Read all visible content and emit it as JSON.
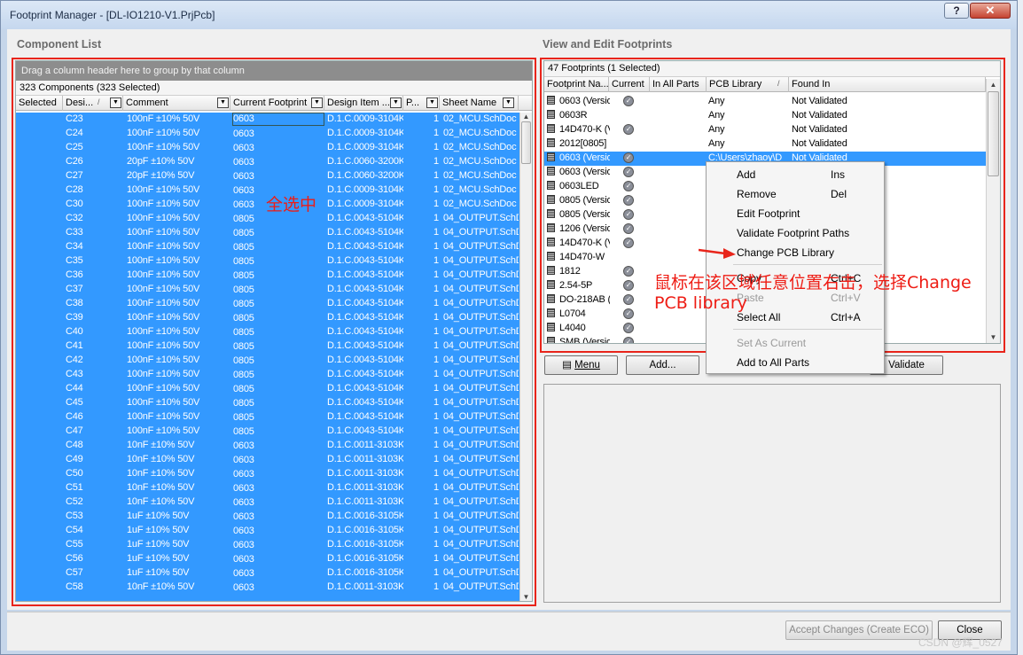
{
  "window": {
    "title": "Footprint Manager - [DL-IO1210-V1.PrjPcb]",
    "help_label": "?",
    "close_label": "✕"
  },
  "left": {
    "group_title": "Component List",
    "group_panel": "Drag a column header here to group by that column",
    "count": "323 Components (323 Selected)",
    "columns": [
      "Selected",
      "Desi...",
      "Comment",
      "Current Footprint",
      "Design Item ...",
      "P...",
      "Sheet Name"
    ],
    "rows": [
      {
        "des": "C23",
        "comment": "100nF ±10% 50V",
        "fp": "0603",
        "item": "D.1.C.0009-3104K",
        "p": "1",
        "sheet": "02_MCU.SchDoc"
      },
      {
        "des": "C24",
        "comment": "100nF ±10% 50V",
        "fp": "0603",
        "item": "D.1.C.0009-3104K",
        "p": "1",
        "sheet": "02_MCU.SchDoc"
      },
      {
        "des": "C25",
        "comment": "100nF ±10% 50V",
        "fp": "0603",
        "item": "D.1.C.0009-3104K",
        "p": "1",
        "sheet": "02_MCU.SchDoc"
      },
      {
        "des": "C26",
        "comment": "20pF ±10%  50V",
        "fp": "0603",
        "item": "D.1.C.0060-3200K",
        "p": "1",
        "sheet": "02_MCU.SchDoc"
      },
      {
        "des": "C27",
        "comment": "20pF ±10%  50V",
        "fp": "0603",
        "item": "D.1.C.0060-3200K",
        "p": "1",
        "sheet": "02_MCU.SchDoc"
      },
      {
        "des": "C28",
        "comment": "100nF ±10% 50V",
        "fp": "0603",
        "item": "D.1.C.0009-3104K",
        "p": "1",
        "sheet": "02_MCU.SchDoc"
      },
      {
        "des": "C30",
        "comment": "100nF ±10% 50V",
        "fp": "0603",
        "item": "D.1.C.0009-3104K",
        "p": "1",
        "sheet": "02_MCU.SchDoc"
      },
      {
        "des": "C32",
        "comment": "100nF ±10% 50V",
        "fp": "0805",
        "item": "D.1.C.0043-5104K",
        "p": "1",
        "sheet": "04_OUTPUT.SchDoc"
      },
      {
        "des": "C33",
        "comment": "100nF ±10% 50V",
        "fp": "0805",
        "item": "D.1.C.0043-5104K",
        "p": "1",
        "sheet": "04_OUTPUT.SchDoc"
      },
      {
        "des": "C34",
        "comment": "100nF ±10% 50V",
        "fp": "0805",
        "item": "D.1.C.0043-5104K",
        "p": "1",
        "sheet": "04_OUTPUT.SchDoc"
      },
      {
        "des": "C35",
        "comment": "100nF ±10% 50V",
        "fp": "0805",
        "item": "D.1.C.0043-5104K",
        "p": "1",
        "sheet": "04_OUTPUT.SchDoc"
      },
      {
        "des": "C36",
        "comment": "100nF ±10% 50V",
        "fp": "0805",
        "item": "D.1.C.0043-5104K",
        "p": "1",
        "sheet": "04_OUTPUT.SchDoc"
      },
      {
        "des": "C37",
        "comment": "100nF ±10% 50V",
        "fp": "0805",
        "item": "D.1.C.0043-5104K",
        "p": "1",
        "sheet": "04_OUTPUT.SchDoc"
      },
      {
        "des": "C38",
        "comment": "100nF ±10% 50V",
        "fp": "0805",
        "item": "D.1.C.0043-5104K",
        "p": "1",
        "sheet": "04_OUTPUT.SchDoc"
      },
      {
        "des": "C39",
        "comment": "100nF ±10% 50V",
        "fp": "0805",
        "item": "D.1.C.0043-5104K",
        "p": "1",
        "sheet": "04_OUTPUT.SchDoc"
      },
      {
        "des": "C40",
        "comment": "100nF ±10% 50V",
        "fp": "0805",
        "item": "D.1.C.0043-5104K",
        "p": "1",
        "sheet": "04_OUTPUT.SchDoc"
      },
      {
        "des": "C41",
        "comment": "100nF ±10% 50V",
        "fp": "0805",
        "item": "D.1.C.0043-5104K",
        "p": "1",
        "sheet": "04_OUTPUT.SchDoc"
      },
      {
        "des": "C42",
        "comment": "100nF ±10% 50V",
        "fp": "0805",
        "item": "D.1.C.0043-5104K",
        "p": "1",
        "sheet": "04_OUTPUT.SchDoc"
      },
      {
        "des": "C43",
        "comment": "100nF ±10% 50V",
        "fp": "0805",
        "item": "D.1.C.0043-5104K",
        "p": "1",
        "sheet": "04_OUTPUT.SchDoc"
      },
      {
        "des": "C44",
        "comment": "100nF ±10% 50V",
        "fp": "0805",
        "item": "D.1.C.0043-5104K",
        "p": "1",
        "sheet": "04_OUTPUT.SchDoc"
      },
      {
        "des": "C45",
        "comment": "100nF ±10% 50V",
        "fp": "0805",
        "item": "D.1.C.0043-5104K",
        "p": "1",
        "sheet": "04_OUTPUT.SchDoc"
      },
      {
        "des": "C46",
        "comment": "100nF ±10% 50V",
        "fp": "0805",
        "item": "D.1.C.0043-5104K",
        "p": "1",
        "sheet": "04_OUTPUT.SchDoc"
      },
      {
        "des": "C47",
        "comment": "100nF ±10% 50V",
        "fp": "0805",
        "item": "D.1.C.0043-5104K",
        "p": "1",
        "sheet": "04_OUTPUT.SchDoc"
      },
      {
        "des": "C48",
        "comment": "10nF ±10% 50V",
        "fp": "0603",
        "item": "D.1.C.0011-3103K",
        "p": "1",
        "sheet": "04_OUTPUT.SchDoc"
      },
      {
        "des": "C49",
        "comment": "10nF ±10% 50V",
        "fp": "0603",
        "item": "D.1.C.0011-3103K",
        "p": "1",
        "sheet": "04_OUTPUT.SchDoc"
      },
      {
        "des": "C50",
        "comment": "10nF ±10% 50V",
        "fp": "0603",
        "item": "D.1.C.0011-3103K",
        "p": "1",
        "sheet": "04_OUTPUT.SchDoc"
      },
      {
        "des": "C51",
        "comment": "10nF ±10% 50V",
        "fp": "0603",
        "item": "D.1.C.0011-3103K",
        "p": "1",
        "sheet": "04_OUTPUT.SchDoc"
      },
      {
        "des": "C52",
        "comment": "10nF ±10% 50V",
        "fp": "0603",
        "item": "D.1.C.0011-3103K",
        "p": "1",
        "sheet": "04_OUTPUT.SchDoc"
      },
      {
        "des": "C53",
        "comment": "1uF ±10% 50V",
        "fp": "0603",
        "item": "D.1.C.0016-3105K",
        "p": "1",
        "sheet": "04_OUTPUT.SchDoc"
      },
      {
        "des": "C54",
        "comment": "1uF ±10% 50V",
        "fp": "0603",
        "item": "D.1.C.0016-3105K",
        "p": "1",
        "sheet": "04_OUTPUT.SchDoc"
      },
      {
        "des": "C55",
        "comment": "1uF ±10% 50V",
        "fp": "0603",
        "item": "D.1.C.0016-3105K",
        "p": "1",
        "sheet": "04_OUTPUT.SchDoc"
      },
      {
        "des": "C56",
        "comment": "1uF ±10% 50V",
        "fp": "0603",
        "item": "D.1.C.0016-3105K",
        "p": "1",
        "sheet": "04_OUTPUT.SchDoc"
      },
      {
        "des": "C57",
        "comment": "1uF ±10% 50V",
        "fp": "0603",
        "item": "D.1.C.0016-3105K",
        "p": "1",
        "sheet": "04_OUTPUT.SchDoc"
      },
      {
        "des": "C58",
        "comment": "10nF ±10% 50V",
        "fp": "0603",
        "item": "D.1.C.0011-3103K",
        "p": "1",
        "sheet": "04_OUTPUT.SchDoc"
      }
    ]
  },
  "right": {
    "group_title": "View and Edit Footprints",
    "count": "47 Footprints (1 Selected)",
    "columns": [
      "Footprint Na...",
      "Current",
      "In All Parts",
      "PCB Library",
      "Found In"
    ],
    "rows": [
      {
        "name": "0603 (Versio",
        "current": true,
        "pcb": "Any",
        "found": "Not Validated"
      },
      {
        "name": "0603R",
        "current": false,
        "pcb": "Any",
        "found": "Not Validated"
      },
      {
        "name": "14D470-K (V",
        "current": true,
        "pcb": "Any",
        "found": "Not Validated"
      },
      {
        "name": "2012[0805]",
        "current": false,
        "pcb": "Any",
        "found": "Not Validated"
      },
      {
        "name": "0603 (Versio",
        "current": true,
        "pcb": "C:\\Users\\zhaoy\\D",
        "found": "Not Validated",
        "selected": true
      },
      {
        "name": "0603 (Versio",
        "current": true,
        "pcb": "",
        "found": ""
      },
      {
        "name": "0603LED",
        "current": true,
        "pcb": "",
        "found": ""
      },
      {
        "name": "0805 (Versio",
        "current": true,
        "pcb": "",
        "found": ""
      },
      {
        "name": "0805 (Versio",
        "current": true,
        "pcb": "",
        "found": ""
      },
      {
        "name": "1206 (Versio",
        "current": true,
        "pcb": "",
        "found": ""
      },
      {
        "name": "14D470-K (V",
        "current": true,
        "pcb": "",
        "found": ""
      },
      {
        "name": "14D470-W",
        "current": false,
        "pcb": "",
        "found": ""
      },
      {
        "name": "1812",
        "current": true,
        "pcb": "",
        "found": ""
      },
      {
        "name": "2.54-5P",
        "current": true,
        "pcb": "",
        "found": ""
      },
      {
        "name": "DO-218AB (",
        "current": true,
        "pcb": "",
        "found": ""
      },
      {
        "name": "L0704",
        "current": true,
        "pcb": "",
        "found": ""
      },
      {
        "name": "L4040",
        "current": true,
        "pcb": "",
        "found": ""
      },
      {
        "name": "SMB (Versio",
        "current": true,
        "pcb": "",
        "found": ""
      }
    ],
    "menu_button": "Menu",
    "add_button": "Add...",
    "validate_button": "Validate"
  },
  "context_menu": {
    "items": [
      {
        "label": "Add",
        "key": "Ins",
        "disabled": false
      },
      {
        "label": "Remove",
        "key": "Del",
        "disabled": false
      },
      {
        "label": "Edit Footprint",
        "key": "",
        "disabled": false
      },
      {
        "label": "Validate Footprint Paths",
        "key": "",
        "disabled": false
      },
      {
        "label": "Change PCB Library",
        "key": "",
        "disabled": false
      },
      {
        "label": "Copy",
        "key": "Ctrl+C",
        "disabled": false
      },
      {
        "label": "Paste",
        "key": "Ctrl+V",
        "disabled": true
      },
      {
        "label": "Select All",
        "key": "Ctrl+A",
        "disabled": false
      },
      {
        "label": "Set As Current",
        "key": "",
        "disabled": true
      },
      {
        "label": "Add to All Parts",
        "key": "",
        "disabled": false
      }
    ]
  },
  "annotations": {
    "select_all": "全选中",
    "instruction_line1": "鼠标在该区域任意位置右击，选择Change",
    "instruction_line2": "PCB library"
  },
  "footer": {
    "accept_button": "Accept Changes (Create ECO)",
    "close_button": "Close",
    "watermark": "CSDN @辉_0527"
  },
  "colors": {
    "selection": "#3399ff",
    "annotation_red": "#e8251b",
    "group_panel": "#8d8d8d"
  }
}
